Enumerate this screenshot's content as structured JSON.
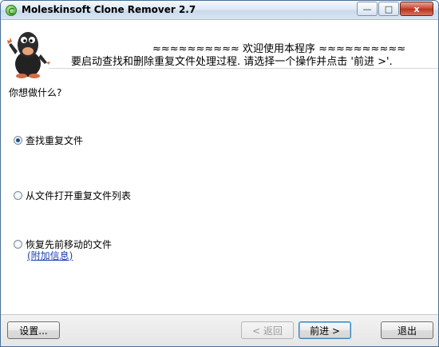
{
  "window": {
    "title": "Moleskinsoft Clone Remover 2.7",
    "icon": "app-logo-icon",
    "controls": {
      "minimize": "—",
      "maximize": "□",
      "close": "x"
    }
  },
  "header": {
    "welcome": "≈≈≈≈≈≈≈≈≈≈ 欢迎使用本程序 ≈≈≈≈≈≈≈≈≈≈",
    "instruction": "要启动查找和删除重复文件处理过程. 请选择一个操作并点击 '前进 >'.",
    "mascot": "mole-mascot-icon"
  },
  "main": {
    "question": "你想做什么?",
    "options": [
      {
        "label": "查找重复文件",
        "selected": true
      },
      {
        "label": "从文件打开重复文件列表",
        "selected": false
      },
      {
        "label": "恢复先前移动的文件",
        "selected": false
      }
    ],
    "more_info_link": "(附加信息)"
  },
  "footer": {
    "settings": "设置...",
    "back": "< 返回",
    "next": "前进 >",
    "exit": "退出"
  },
  "colors": {
    "title_bar": "#cad9ea",
    "link": "#1a3fb5",
    "radio_dot": "#1a4b8f"
  }
}
